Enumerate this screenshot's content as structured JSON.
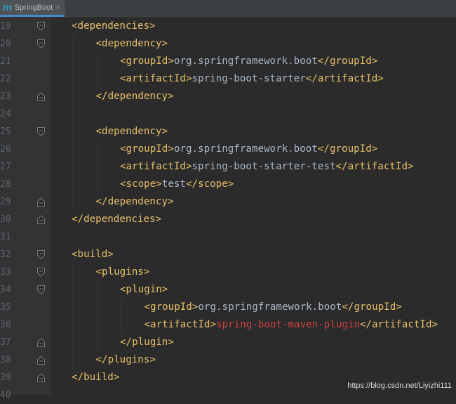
{
  "tab": {
    "icon": "maven-m-icon",
    "label": "SpringBoot",
    "close": "×"
  },
  "lines": [
    {
      "num": "19",
      "fold": "open",
      "indent": 1,
      "parts": [
        [
          "tag",
          "<dependencies>"
        ]
      ]
    },
    {
      "num": "20",
      "fold": "open",
      "indent": 2,
      "parts": [
        [
          "tag",
          "<dependency>"
        ]
      ]
    },
    {
      "num": "21",
      "fold": "",
      "indent": 3,
      "parts": [
        [
          "tag",
          "<groupId>"
        ],
        [
          "txt",
          "org.springframework.boot"
        ],
        [
          "tag",
          "</groupId>"
        ]
      ]
    },
    {
      "num": "22",
      "fold": "",
      "indent": 3,
      "parts": [
        [
          "tag",
          "<artifactId>"
        ],
        [
          "txt",
          "spring-boot-starter"
        ],
        [
          "tag",
          "</artifactId>"
        ]
      ]
    },
    {
      "num": "23",
      "fold": "close",
      "indent": 2,
      "parts": [
        [
          "tag",
          "</dependency>"
        ]
      ]
    },
    {
      "num": "24",
      "fold": "",
      "indent": 0,
      "parts": []
    },
    {
      "num": "25",
      "fold": "open",
      "indent": 2,
      "parts": [
        [
          "tag",
          "<dependency>"
        ]
      ]
    },
    {
      "num": "26",
      "fold": "",
      "indent": 3,
      "parts": [
        [
          "tag",
          "<groupId>"
        ],
        [
          "txt",
          "org.springframework.boot"
        ],
        [
          "tag",
          "</groupId>"
        ]
      ]
    },
    {
      "num": "27",
      "fold": "",
      "indent": 3,
      "parts": [
        [
          "tag",
          "<artifactId>"
        ],
        [
          "txt",
          "spring-boot-starter-test"
        ],
        [
          "tag",
          "</artifactId>"
        ]
      ]
    },
    {
      "num": "28",
      "fold": "",
      "indent": 3,
      "parts": [
        [
          "tag",
          "<scope>"
        ],
        [
          "txt",
          "test"
        ],
        [
          "tag",
          "</scope>"
        ]
      ]
    },
    {
      "num": "29",
      "fold": "close",
      "indent": 2,
      "parts": [
        [
          "tag",
          "</dependency>"
        ]
      ]
    },
    {
      "num": "30",
      "fold": "close",
      "indent": 1,
      "parts": [
        [
          "tag",
          "</dependencies>"
        ]
      ]
    },
    {
      "num": "31",
      "fold": "",
      "indent": 0,
      "parts": []
    },
    {
      "num": "32",
      "fold": "open",
      "indent": 1,
      "parts": [
        [
          "tag",
          "<build>"
        ]
      ]
    },
    {
      "num": "33",
      "fold": "open",
      "indent": 2,
      "parts": [
        [
          "tag",
          "<plugins>"
        ]
      ]
    },
    {
      "num": "34",
      "fold": "open",
      "indent": 3,
      "parts": [
        [
          "tag",
          "<plugin>"
        ]
      ]
    },
    {
      "num": "35",
      "fold": "",
      "indent": 4,
      "parts": [
        [
          "tag",
          "<groupId>"
        ],
        [
          "txt",
          "org.springframework.boot"
        ],
        [
          "tag",
          "</groupId>"
        ]
      ]
    },
    {
      "num": "36",
      "fold": "",
      "indent": 4,
      "parts": [
        [
          "tag",
          "<artifactId>"
        ],
        [
          "hl",
          "spring-boot-maven-plugin"
        ],
        [
          "tag",
          "</artifactId>"
        ]
      ]
    },
    {
      "num": "37",
      "fold": "close",
      "indent": 3,
      "parts": [
        [
          "tag",
          "</plugin>"
        ]
      ]
    },
    {
      "num": "38",
      "fold": "close",
      "indent": 2,
      "parts": [
        [
          "tag",
          "</plugins>"
        ]
      ]
    },
    {
      "num": "39",
      "fold": "close",
      "indent": 1,
      "parts": [
        [
          "tag",
          "</build>"
        ]
      ]
    },
    {
      "num": "40",
      "fold": "",
      "indent": 0,
      "parts": []
    }
  ],
  "watermark": "https://blog.csdn.net/Liyizhi111",
  "colors": {
    "tag": "#e8bf6a",
    "text": "#a9b7c6",
    "error": "#cc3f3f",
    "line_number": "#606366",
    "background": "#2b2b2b"
  }
}
